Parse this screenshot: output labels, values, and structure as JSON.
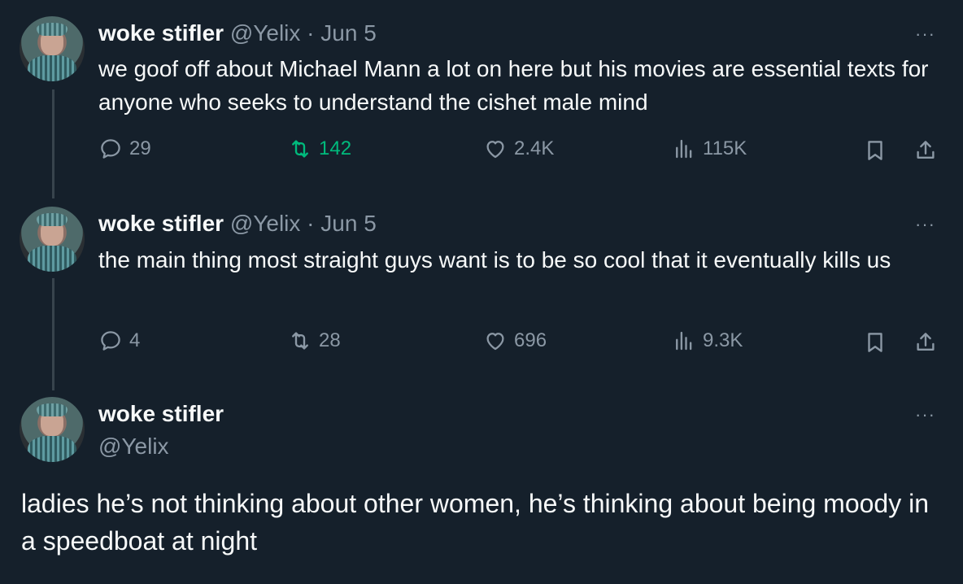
{
  "tweets": [
    {
      "name": "woke stifler",
      "handle": "@Yelix",
      "dot": "·",
      "date": "Jun 5",
      "more": "···",
      "text": "we goof off about Michael Mann a lot on here but his movies are essential texts for anyone who seeks to understand the cishet male mind",
      "replies": "29",
      "retweets": "142",
      "likes": "2.4K",
      "views": "115K"
    },
    {
      "name": "woke stifler",
      "handle": "@Yelix",
      "dot": "·",
      "date": "Jun 5",
      "more": "···",
      "text": "the main thing most straight guys want is to be so cool that it eventually kills us",
      "replies": "4",
      "retweets": "28",
      "likes": "696",
      "views": "9.3K"
    }
  ],
  "focused": {
    "name": "woke stifler",
    "handle": "@Yelix",
    "more": "···",
    "text": "ladies he’s not thinking about other women, he’s thinking about being moody in a speedboat at night"
  },
  "colors": {
    "background": "#15202b",
    "text": "#f7f9f9",
    "muted": "#8b98a5",
    "retweeted": "#00ba7c",
    "thread_line": "#38444d"
  },
  "icons": [
    "reply-icon",
    "retweet-icon",
    "like-icon",
    "views-icon",
    "bookmark-icon",
    "share-icon",
    "more-icon"
  ]
}
